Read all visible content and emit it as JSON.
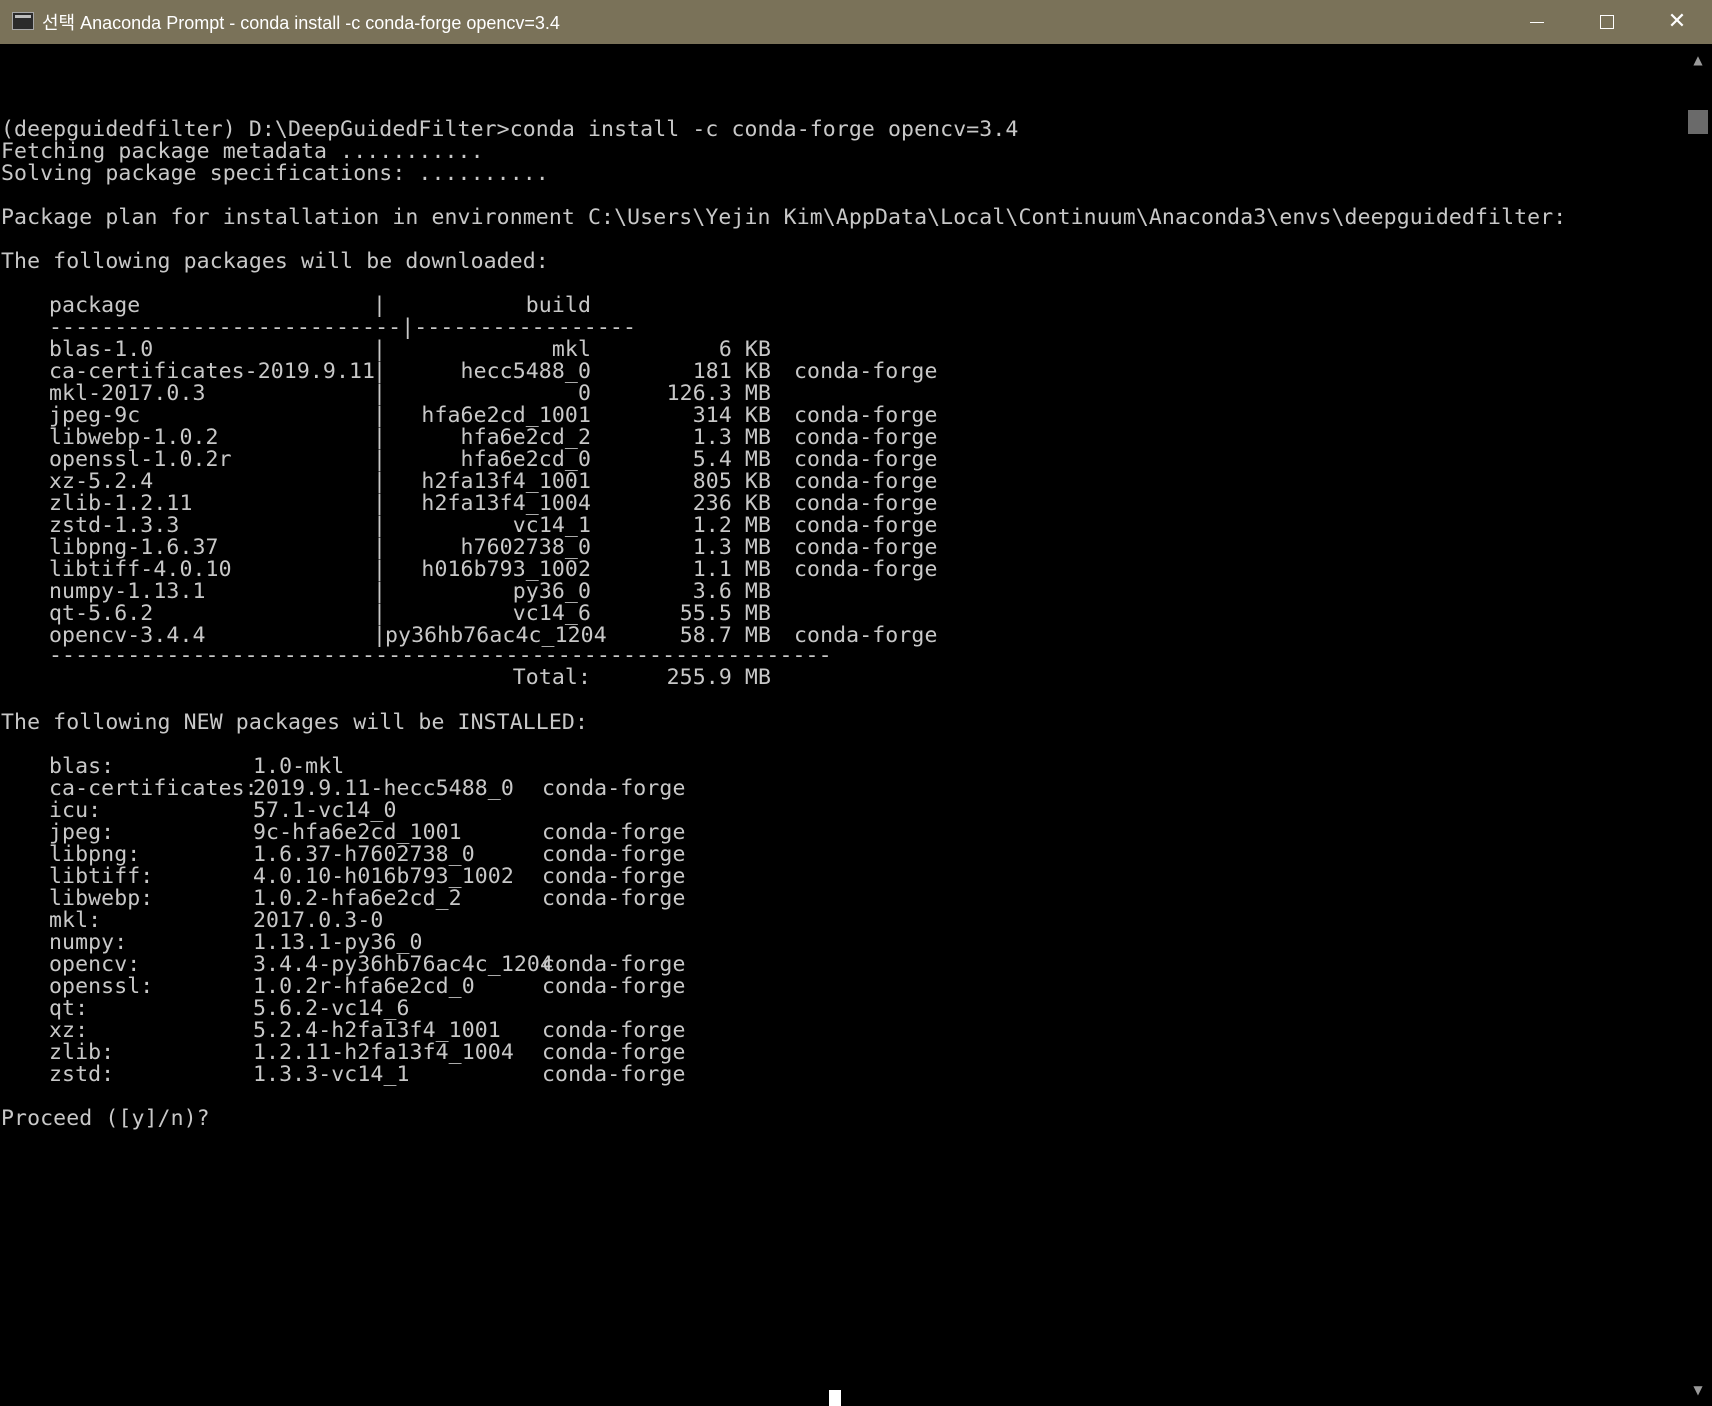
{
  "window": {
    "title": "선택 Anaconda Prompt - conda  install -c conda-forge opencv=3.4",
    "minimize_icon": "minimize-icon",
    "maximize_icon": "maximize-icon",
    "close_icon": "close-icon",
    "close_glyph": "✕"
  },
  "terminal": {
    "command_line": "(deepguidedfilter) D:\\DeepGuidedFilter>conda install -c conda-forge opencv=3.4",
    "fetching": "Fetching package metadata ...........",
    "solving": "Solving package specifications: ..........",
    "plan": "Package plan for installation in environment C:\\Users\\Yejin Kim\\AppData\\Local\\Continuum\\Anaconda3\\envs\\deepguidedfilter:",
    "download_heading": "The following packages will be downloaded:",
    "download_header": {
      "package": "package",
      "sep": "|",
      "build": "build"
    },
    "download_rule": "---------------------------|-----------------",
    "downloads": [
      {
        "package": "blas-1.0",
        "build": "mkl",
        "size": "6 KB",
        "channel": ""
      },
      {
        "package": "ca-certificates-2019.9.11",
        "build": "hecc5488_0",
        "size": "181 KB",
        "channel": "conda-forge"
      },
      {
        "package": "mkl-2017.0.3",
        "build": "0",
        "size": "126.3 MB",
        "channel": ""
      },
      {
        "package": "jpeg-9c",
        "build": "hfa6e2cd_1001",
        "size": "314 KB",
        "channel": "conda-forge"
      },
      {
        "package": "libwebp-1.0.2",
        "build": "hfa6e2cd_2",
        "size": "1.3 MB",
        "channel": "conda-forge"
      },
      {
        "package": "openssl-1.0.2r",
        "build": "hfa6e2cd_0",
        "size": "5.4 MB",
        "channel": "conda-forge"
      },
      {
        "package": "xz-5.2.4",
        "build": "h2fa13f4_1001",
        "size": "805 KB",
        "channel": "conda-forge"
      },
      {
        "package": "zlib-1.2.11",
        "build": "h2fa13f4_1004",
        "size": "236 KB",
        "channel": "conda-forge"
      },
      {
        "package": "zstd-1.3.3",
        "build": "vc14_1",
        "size": "1.2 MB",
        "channel": "conda-forge"
      },
      {
        "package": "libpng-1.6.37",
        "build": "h7602738_0",
        "size": "1.3 MB",
        "channel": "conda-forge"
      },
      {
        "package": "libtiff-4.0.10",
        "build": "h016b793_1002",
        "size": "1.1 MB",
        "channel": "conda-forge"
      },
      {
        "package": "numpy-1.13.1",
        "build": "py36_0",
        "size": "3.6 MB",
        "channel": ""
      },
      {
        "package": "qt-5.6.2",
        "build": "vc14_6",
        "size": "55.5 MB",
        "channel": ""
      },
      {
        "package": "opencv-3.4.4",
        "build": "py36hb76ac4c_1204",
        "size": "58.7 MB",
        "channel": "conda-forge"
      }
    ],
    "total_rule": "------------------------------------------------------------",
    "total_label": "Total:",
    "total_value": "255.9 MB",
    "install_heading": "The following NEW packages will be INSTALLED:",
    "installs": [
      {
        "name": "blas:",
        "version": "1.0-mkl",
        "channel": ""
      },
      {
        "name": "ca-certificates:",
        "version": "2019.9.11-hecc5488_0",
        "channel": "conda-forge"
      },
      {
        "name": "icu:",
        "version": "57.1-vc14_0",
        "channel": ""
      },
      {
        "name": "jpeg:",
        "version": "9c-hfa6e2cd_1001",
        "channel": "conda-forge"
      },
      {
        "name": "libpng:",
        "version": "1.6.37-h7602738_0",
        "channel": "conda-forge"
      },
      {
        "name": "libtiff:",
        "version": "4.0.10-h016b793_1002",
        "channel": "conda-forge"
      },
      {
        "name": "libwebp:",
        "version": "1.0.2-hfa6e2cd_2",
        "channel": "conda-forge"
      },
      {
        "name": "mkl:",
        "version": "2017.0.3-0",
        "channel": ""
      },
      {
        "name": "numpy:",
        "version": "1.13.1-py36_0",
        "channel": ""
      },
      {
        "name": "opencv:",
        "version": "3.4.4-py36hb76ac4c_1204",
        "channel": "conda-forge"
      },
      {
        "name": "openssl:",
        "version": "1.0.2r-hfa6e2cd_0",
        "channel": "conda-forge"
      },
      {
        "name": "qt:",
        "version": "5.6.2-vc14_6",
        "channel": ""
      },
      {
        "name": "xz:",
        "version": "5.2.4-h2fa13f4_1001",
        "channel": "conda-forge"
      },
      {
        "name": "zlib:",
        "version": "1.2.11-h2fa13f4_1004",
        "channel": "conda-forge"
      },
      {
        "name": "zstd:",
        "version": "1.3.3-vc14_1",
        "channel": "conda-forge"
      }
    ],
    "prompt": "Proceed ([y]/n)?"
  },
  "scrollbar": {
    "up_glyph": "▲",
    "down_glyph": "▼"
  }
}
